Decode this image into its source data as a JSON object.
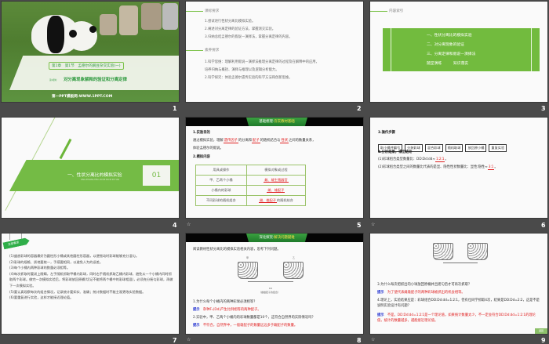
{
  "slides": [
    {
      "num": "1",
      "chapter": "第1章　第1节　孟德尔的豌豆杂交实验(一)",
      "lesson_tag": "第2课时",
      "title": "对分离现象解释的验证和分离定律",
      "footer": "第一PPT模板网-WWW.1PPT.COM"
    },
    {
      "num": "2",
      "h1": "课标要求",
      "l1": [
        "1.尝试进行性状分离比模拟实验。",
        "2.阐述对分离定律的验证方法，掌握测交实验。",
        "3.归纳总结孟德尔的假说—演绎法，掌握分离定律的内容。"
      ],
      "h2": "素养要求",
      "l2": [
        "1.科学思维：理解利用假说—演绎法推理分离定律的过程及在解释中的应用，",
        "培养归纳与概括、演绎与推理以及逻辑分析能力。",
        "2.科学探究：体验孟德尔遗传实验的科学方法和创新思维。"
      ]
    },
    {
      "num": "3",
      "h": "内容索引",
      "items": [
        "一、性状分离比的模拟实验",
        "二、对分离现象的验证",
        "三、分离定律和假说—演绎法"
      ],
      "extra1": "随堂演练",
      "extra2": "知识落实"
    },
    {
      "num": "4",
      "title": "一、性状分离比的模拟实验",
      "sub": "XING ZHUANG FEN LI BI DE MO NI SHI YAN",
      "badge": "01"
    },
    {
      "num": "5",
      "tab_a": "基础梳理·",
      "tab_b": "夯实教材基础",
      "h1": "1.实验目的",
      "p1a": "通过模拟实验，理解",
      "f1": "遗传因子",
      "p1b": "的分离和",
      "f2": "配子",
      "p1c": "的随机结合与",
      "f3": "性状",
      "p1d": "之间的数量关系，",
      "p1e": "体验孟德尔的假说。",
      "h2": "2.模拟内容",
      "table": [
        [
          "用具或操作",
          "模拟对象或过程"
        ],
        [
          "甲、乙两个小桶",
          "雌、雄生殖器官"
        ],
        [
          "小桶内的彩球",
          "雌、雄配子"
        ],
        [
          "不同彩球的随机组合",
          "雌、雄配子",
          "的随机结合"
        ]
      ]
    },
    {
      "num": "6",
      "h3": "3.操作步骤",
      "steps": [
        "取小桶并编号",
        "分装彩球",
        "混合彩球",
        "随机取球",
        "放回原小桶",
        "重复实验"
      ],
      "h4": "4.分析结果，得出结论",
      "r1": "(1)彩球组合类型数量比：DD∶Dd∶dd≈",
      "r1v": "1∶2∶1",
      "r2": "(2)彩球组合类型之间的数量比代表的是显、隐性性状数量比：显性∶隐性≈",
      "r2v": "3∶1"
    },
    {
      "num": "7",
      "tag": "注意事项",
      "items": [
        "(1)盛放彩球的容器最好为圆柱形小桶或其他圆柱形容器，以便摇动时彩球能够充分混匀。",
        "(2)彩球的规格、质地要统一，手感要相同，以避免人为的误差。",
        "(3)每个小桶内两种彩球的数量必须相等。",
        "(4)每次抓取时要闭上眼睛，左手随机抓取甲桶内彩球，同时右手随机抓取乙桶内彩球，避免从一个小桶内同时抓取两个彩球。做完一次模拟实验后，将彩球放回原桶(切记不能将两个桶中的彩球相混)，必须充分摇匀彩球，再做下一次模拟实验。",
        "(5)要认真观察每次的组合情况，记录统计要如实、准确；统计数据时不能主观更改实验数据。",
        "(6)要重复进行实验，这样才能接近理论值。"
      ]
    },
    {
      "num": "8",
      "tab_a": "深化探究·",
      "tab_b": "解决问题疑难",
      "intro": "阅读教材性状分离比的模拟实验相关内容，思考下列问题。",
      "fig_a": "甲",
      "fig_b": "乙",
      "fig_c": "Dd",
      "fig_cap": "（雌雄配子的结合）",
      "q1": "1.为什么每个小桶内的两种彩球必须相等？",
      "tip": "提示",
      "a1": "杂种F₁(Dd)产生比例相等的两种配子。",
      "q2": "2.实验中，甲、乙两个小桶内的彩球数量都是10个，这符合自然界的实际情况吗？",
      "a2": "不符合。自然界中，一般雄配子的数量远远多于雌配子的数量。"
    },
    {
      "num": "9",
      "q3": "3.为什么每次把抓出的小球放回原桶并且摇匀后才可再次抓取？",
      "tip": "提示",
      "a3": "为了使代表雌雄配子的两种彩球被抓出的机会相等。",
      "q4": "4.理论上，实验结果应是：彩球组合DD∶Dd∶dd=1∶2∶1，但有位同学抓取4次，结果是DD∶Dd=2∶2，这是不是说明实验设计有问题？",
      "a4": "不是。DD∶Dd∶dd=1∶2∶1是一个理论值，如果统计数量太少，不一定会符合DD∶Dd∶dd=1∶2∶1的理论值，统计的数量越多，越能接近理论值。",
      "back": "返回"
    }
  ],
  "anim_icon": "☆"
}
